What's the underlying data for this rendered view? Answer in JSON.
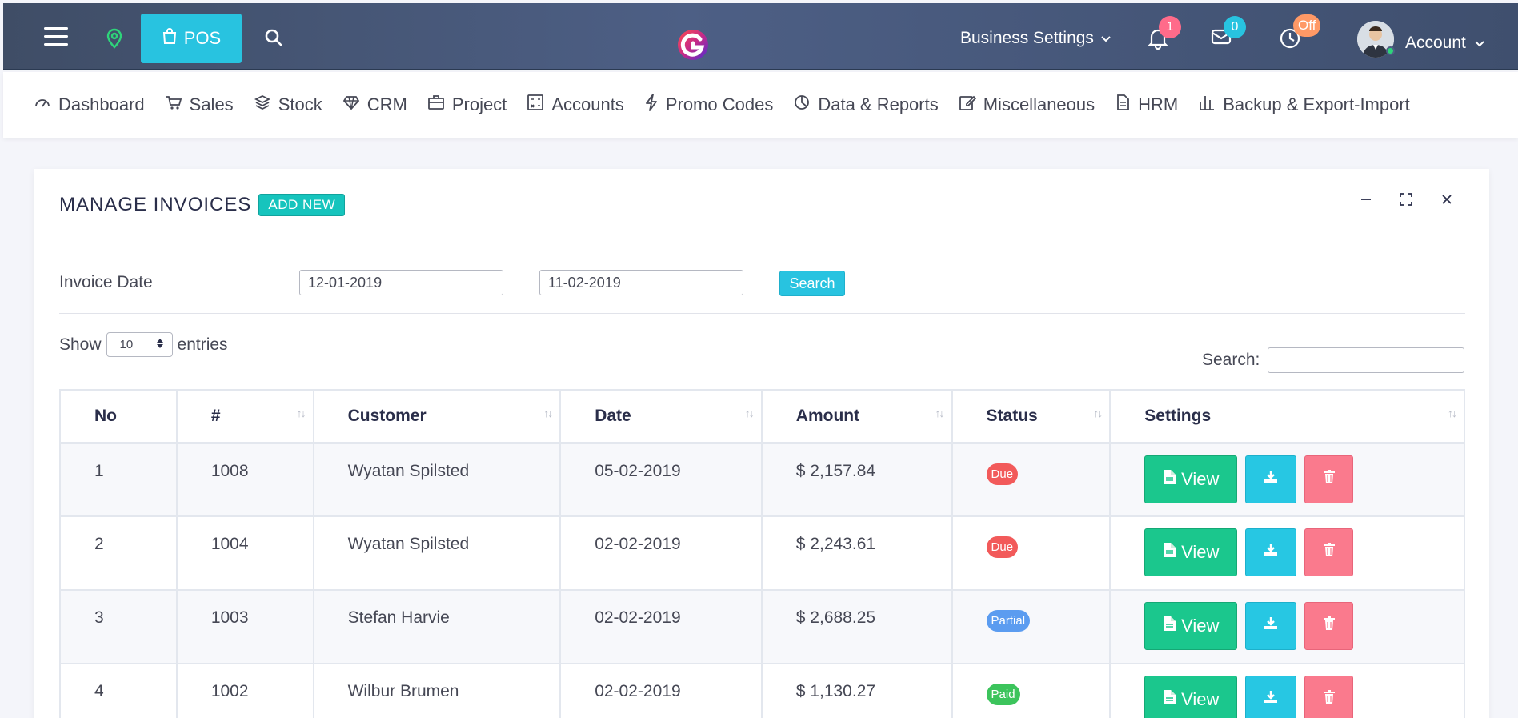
{
  "topbar": {
    "pos_label": "POS",
    "business_settings": "Business Settings",
    "notifications_count": "1",
    "messages_count": "0",
    "timer_status": "Off",
    "account_label": "Account"
  },
  "menu": [
    {
      "label": "Dashboard",
      "icon": "gauge-icon"
    },
    {
      "label": "Sales",
      "icon": "cart-icon"
    },
    {
      "label": "Stock",
      "icon": "layers-icon"
    },
    {
      "label": "CRM",
      "icon": "diamond-icon"
    },
    {
      "label": "Project",
      "icon": "briefcase-icon"
    },
    {
      "label": "Accounts",
      "icon": "calculator-icon"
    },
    {
      "label": "Promo Codes",
      "icon": "bolt-icon"
    },
    {
      "label": "Data & Reports",
      "icon": "pie-icon"
    },
    {
      "label": "Miscellaneous",
      "icon": "edit-icon"
    },
    {
      "label": "HRM",
      "icon": "file-icon"
    },
    {
      "label": "Backup & Export-Import",
      "icon": "bar-chart-icon"
    }
  ],
  "card": {
    "title": "MANAGE INVOICES",
    "add_new": "ADD NEW"
  },
  "filter": {
    "label": "Invoice Date",
    "from_date": "12-01-2019",
    "to_date": "11-02-2019",
    "search_button": "Search"
  },
  "table_controls": {
    "show_label": "Show",
    "entries_value": "10",
    "entries_label": "entries",
    "search_label": "Search:"
  },
  "table": {
    "headers": [
      "No",
      "#",
      "Customer",
      "Date",
      "Amount",
      "Status",
      "Settings"
    ],
    "view_label": "View",
    "rows": [
      {
        "no": "1",
        "id": "1008",
        "customer": "Wyatan Spilsted",
        "date": "05-02-2019",
        "amount": "$ 2,157.84",
        "status": "Due"
      },
      {
        "no": "2",
        "id": "1004",
        "customer": "Wyatan Spilsted",
        "date": "02-02-2019",
        "amount": "$ 2,243.61",
        "status": "Due"
      },
      {
        "no": "3",
        "id": "1003",
        "customer": "Stefan Harvie",
        "date": "02-02-2019",
        "amount": "$ 2,688.25",
        "status": "Partial"
      },
      {
        "no": "4",
        "id": "1002",
        "customer": "Wilbur Brumen",
        "date": "02-02-2019",
        "amount": "$ 1,130.27",
        "status": "Paid"
      }
    ]
  },
  "colors": {
    "status_due": "#f25a5a",
    "status_partial": "#5b9cf0",
    "status_paid": "#3cc45c"
  }
}
